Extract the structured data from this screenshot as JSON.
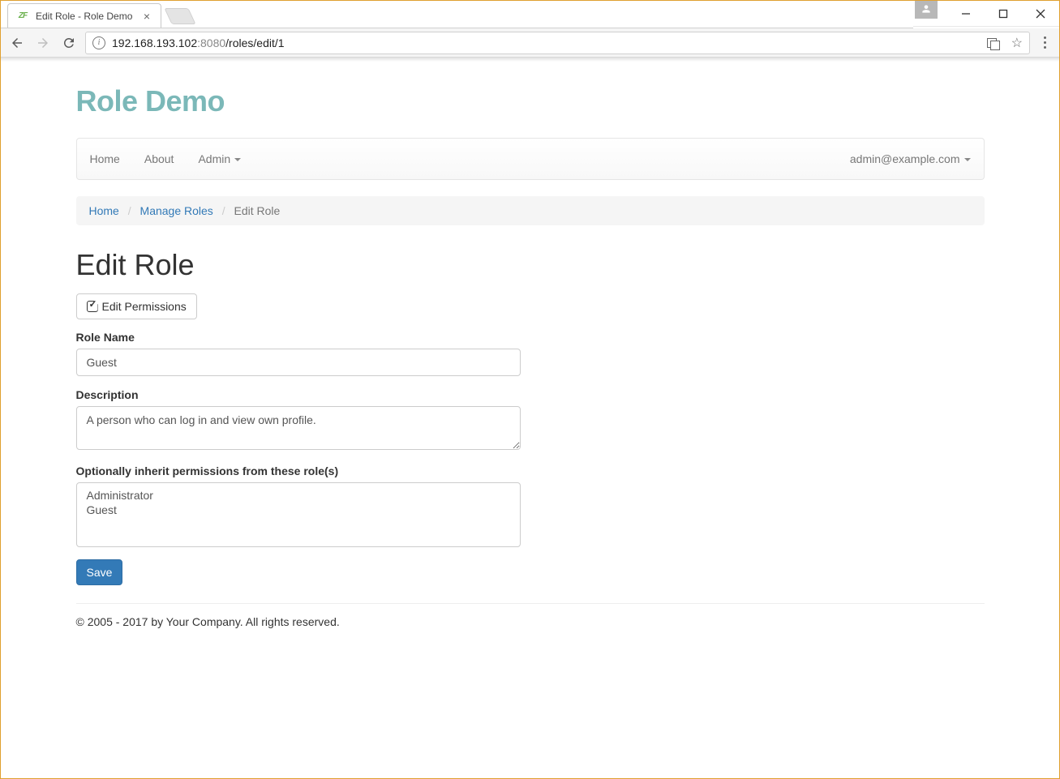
{
  "window": {
    "tab_title": "Edit Role - Role Demo",
    "url_host": "192.168.193.102",
    "url_port": ":8080",
    "url_path": "/roles/edit/1"
  },
  "brand": "Role Demo",
  "navbar": {
    "home": "Home",
    "about": "About",
    "admin": "Admin",
    "user_email": "admin@example.com"
  },
  "breadcrumb": {
    "home": "Home",
    "manage_roles": "Manage Roles",
    "active": "Edit Role"
  },
  "page_title": "Edit Role",
  "buttons": {
    "edit_permissions": "Edit Permissions",
    "save": "Save"
  },
  "form": {
    "role_name_label": "Role Name",
    "role_name_value": "Guest",
    "description_label": "Description",
    "description_value": "A person who can log in and view own profile.",
    "inherit_label": "Optionally inherit permissions from these role(s)",
    "inherit_options": {
      "0": "Administrator",
      "1": "Guest"
    }
  },
  "footer": "© 2005 - 2017 by Your Company. All rights reserved."
}
